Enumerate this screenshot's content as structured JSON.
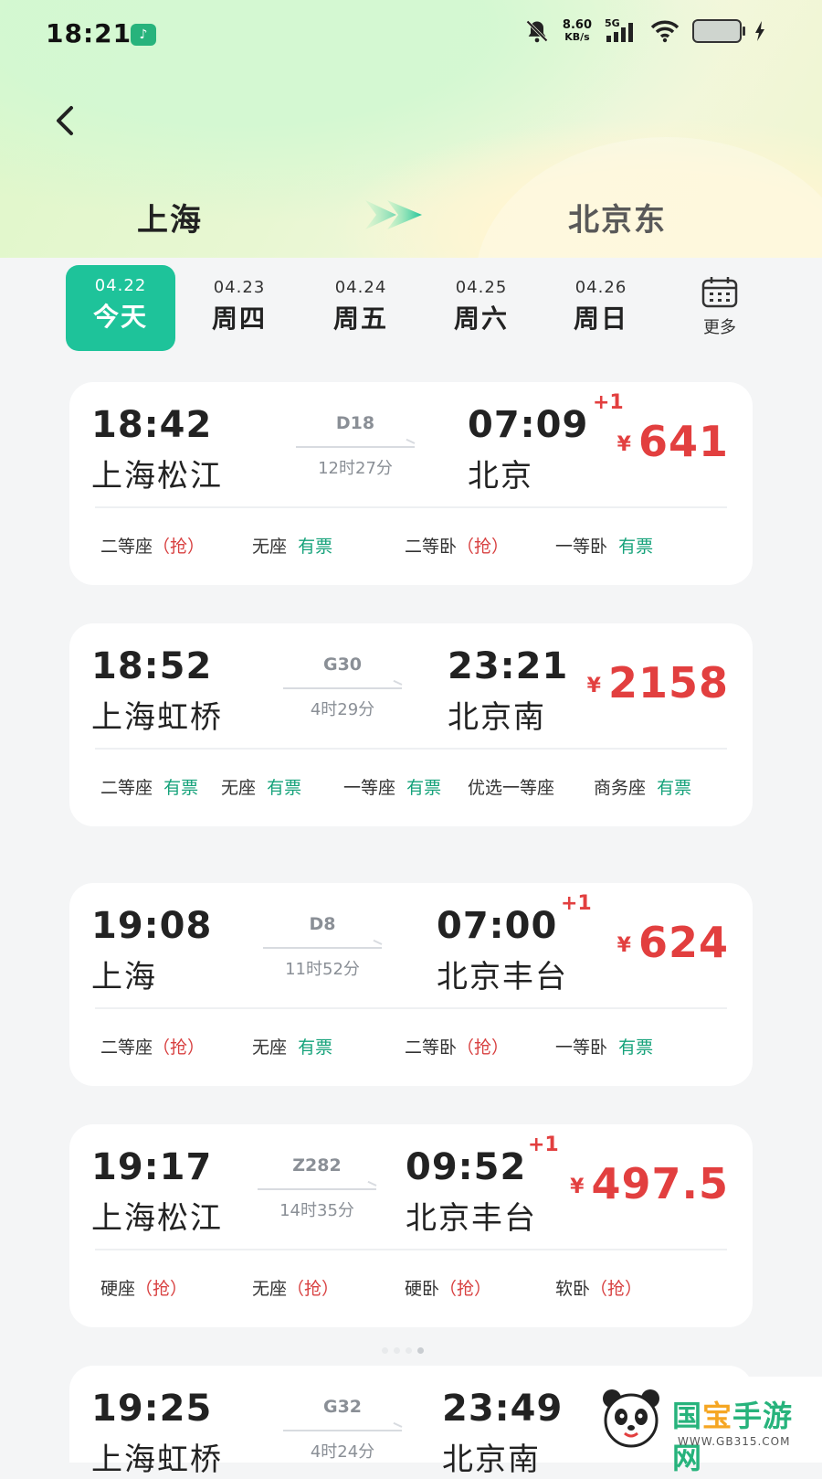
{
  "status_bar": {
    "time": "18:21",
    "speed_value": "8.60",
    "speed_unit": "KB/s",
    "network": "5G"
  },
  "route": {
    "from": "上海",
    "to": "北京东"
  },
  "dates": [
    {
      "date": "04.22",
      "weekday": "今天",
      "active": true
    },
    {
      "date": "04.23",
      "weekday": "周四",
      "active": false
    },
    {
      "date": "04.24",
      "weekday": "周五",
      "active": false
    },
    {
      "date": "04.25",
      "weekday": "周六",
      "active": false
    },
    {
      "date": "04.26",
      "weekday": "周日",
      "active": false
    }
  ],
  "more_label": "更多",
  "trains": [
    {
      "dep_time": "18:42",
      "dep_station": "上海松江",
      "train_no": "D18",
      "duration": "12时27分",
      "arr_time": "07:09",
      "next_day": "+1",
      "arr_station": "北京",
      "currency": "¥",
      "price": "641",
      "seats": [
        {
          "name": "二等座",
          "status": "（抢）",
          "kind": "grab"
        },
        {
          "name": "无座",
          "status": "有票",
          "kind": "ok"
        },
        {
          "name": "二等卧",
          "status": "（抢）",
          "kind": "grab"
        },
        {
          "name": "一等卧",
          "status": "有票",
          "kind": "ok"
        }
      ]
    },
    {
      "dep_time": "18:52",
      "dep_station": "上海虹桥",
      "train_no": "G30",
      "duration": "4时29分",
      "arr_time": "23:21",
      "next_day": "",
      "arr_station": "北京南",
      "currency": "¥",
      "price": "2158",
      "seats": [
        {
          "name": "二等座",
          "status": "有票",
          "kind": "ok"
        },
        {
          "name": "无座",
          "status": "有票",
          "kind": "ok"
        },
        {
          "name": "一等座",
          "status": "有票",
          "kind": "ok"
        },
        {
          "name": "优选一等座",
          "status": "",
          "kind": "ok"
        },
        {
          "name": "商务座",
          "status": "有票",
          "kind": "ok"
        }
      ]
    },
    {
      "dep_time": "19:08",
      "dep_station": "上海",
      "train_no": "D8",
      "duration": "11时52分",
      "arr_time": "07:00",
      "next_day": "+1",
      "arr_station": "北京丰台",
      "currency": "¥",
      "price": "624",
      "seats": [
        {
          "name": "二等座",
          "status": "（抢）",
          "kind": "grab"
        },
        {
          "name": "无座",
          "status": "有票",
          "kind": "ok"
        },
        {
          "name": "二等卧",
          "status": "（抢）",
          "kind": "grab"
        },
        {
          "name": "一等卧",
          "status": "有票",
          "kind": "ok"
        }
      ]
    },
    {
      "dep_time": "19:17",
      "dep_station": "上海松江",
      "train_no": "Z282",
      "duration": "14时35分",
      "arr_time": "09:52",
      "next_day": "+1",
      "arr_station": "北京丰台",
      "currency": "¥",
      "price": "497.5",
      "seats": [
        {
          "name": "硬座",
          "status": "（抢）",
          "kind": "grab"
        },
        {
          "name": "无座",
          "status": "（抢）",
          "kind": "grab"
        },
        {
          "name": "硬卧",
          "status": "（抢）",
          "kind": "grab"
        },
        {
          "name": "软卧",
          "status": "（抢）",
          "kind": "grab"
        }
      ]
    },
    {
      "dep_time": "19:25",
      "dep_station": "上海虹桥",
      "train_no": "G32",
      "duration": "4时24分",
      "arr_time": "23:49",
      "next_day": "",
      "arr_station": "北京南",
      "currency": "¥",
      "price": "",
      "seats": []
    }
  ],
  "watermark": {
    "name_a": "国",
    "name_b": "宝",
    "name_c": "手游网",
    "url": "WWW.GB315.COM"
  },
  "colors": {
    "accent": "#1ec39a",
    "price": "#e23f3f",
    "available": "#15a27a"
  }
}
